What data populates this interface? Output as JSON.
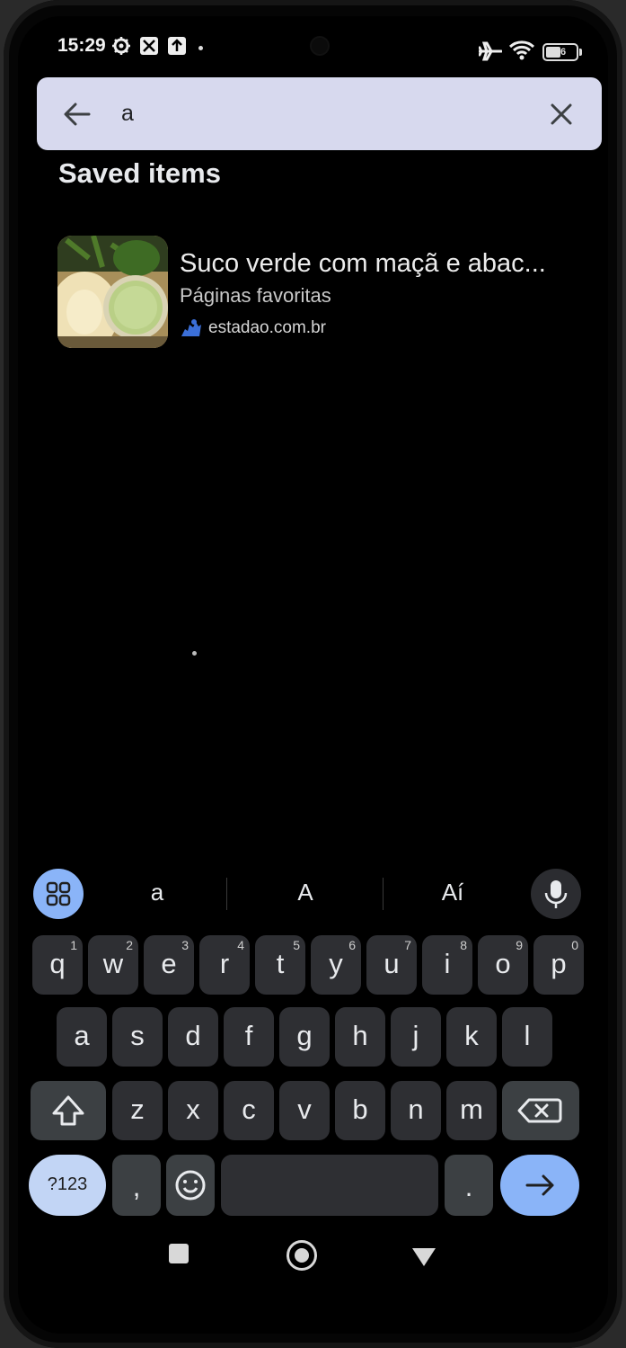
{
  "status_bar": {
    "time": "15:29",
    "battery": "46"
  },
  "search": {
    "query": "a",
    "back_icon": "arrow-left-icon",
    "clear_icon": "close-icon"
  },
  "section": {
    "title": "Saved items"
  },
  "saved_items": [
    {
      "title": "Suco verde com maçã e abac...",
      "folder": "Páginas favoritas",
      "site": "estadao.com.br",
      "site_icon": "estadao-logo-icon"
    }
  ],
  "keyboard": {
    "suggestions": [
      "a",
      "A",
      "Aí"
    ],
    "row1": [
      {
        "ch": "q",
        "num": "1"
      },
      {
        "ch": "w",
        "num": "2"
      },
      {
        "ch": "e",
        "num": "3"
      },
      {
        "ch": "r",
        "num": "4"
      },
      {
        "ch": "t",
        "num": "5"
      },
      {
        "ch": "y",
        "num": "6"
      },
      {
        "ch": "u",
        "num": "7"
      },
      {
        "ch": "i",
        "num": "8"
      },
      {
        "ch": "o",
        "num": "9"
      },
      {
        "ch": "p",
        "num": "0"
      }
    ],
    "row2": [
      "a",
      "s",
      "d",
      "f",
      "g",
      "h",
      "j",
      "k",
      "l"
    ],
    "row3": [
      "z",
      "x",
      "c",
      "v",
      "b",
      "n",
      "m"
    ],
    "symbols_label": "?123",
    "comma": ",",
    "period": ".",
    "colors": {
      "accent": "#8ab4f8",
      "key": "#2e2f33",
      "search_bar": "#d7d9ee"
    }
  }
}
